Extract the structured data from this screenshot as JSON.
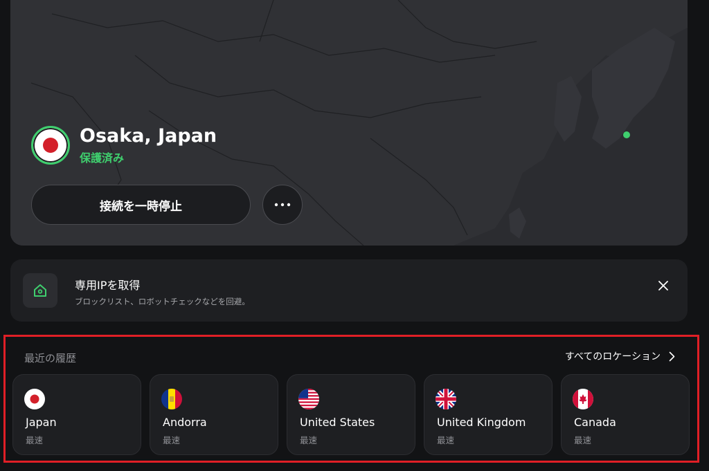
{
  "connection": {
    "location": "Osaka, Japan",
    "status": "保護済み",
    "status_color": "#3fcf6e",
    "flag_icon": "japan-flag-icon",
    "pause_label": "接続を一時停止",
    "more_icon": "more-horizontal-icon"
  },
  "promo": {
    "icon": "home-location-icon",
    "title": "専用IPを取得",
    "subtitle": "ブロックリスト、ロボットチェックなどを回避。",
    "close_icon": "close-icon"
  },
  "history": {
    "title": "最近の履歴",
    "all_locations_label": "すべてのロケーション",
    "chevron_icon": "chevron-right-icon",
    "items": [
      {
        "name": "Japan",
        "speed": "最速",
        "flag_icon": "japan-flag-icon"
      },
      {
        "name": "Andorra",
        "speed": "最速",
        "flag_icon": "andorra-flag-icon"
      },
      {
        "name": "United States",
        "speed": "最速",
        "flag_icon": "us-flag-icon"
      },
      {
        "name": "United Kingdom",
        "speed": "最速",
        "flag_icon": "uk-flag-icon"
      },
      {
        "name": "Canada",
        "speed": "最速",
        "flag_icon": "canada-flag-icon"
      }
    ]
  },
  "colors": {
    "accent_green": "#3fcf6e",
    "highlight_red": "#e01f26",
    "background": "#121315"
  }
}
